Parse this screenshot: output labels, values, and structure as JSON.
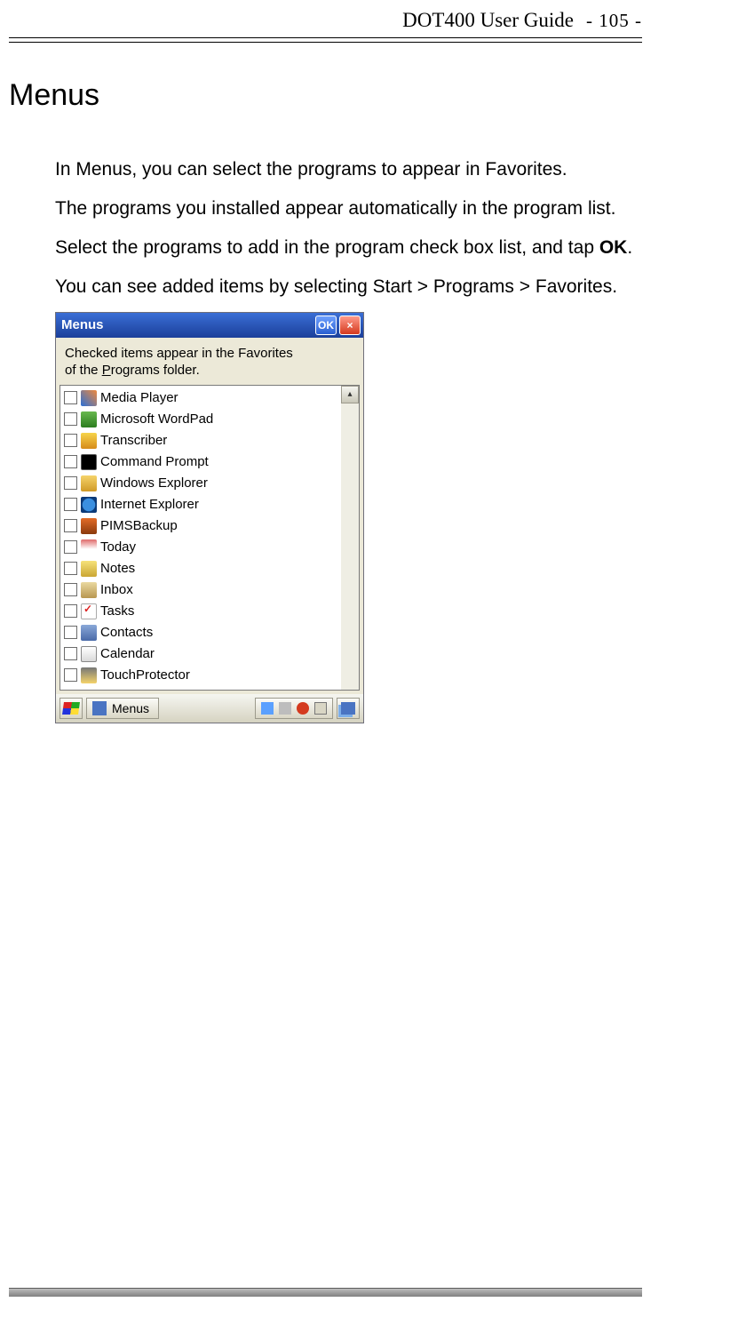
{
  "header": {
    "title": "DOT400 User Guide",
    "page": "- 105 -"
  },
  "heading": "Menus",
  "paragraphs": {
    "p1": "In Menus, you can select the programs to appear in Favorites.",
    "p2": "The programs you installed appear automatically in the program list.",
    "p3_before": "Select the programs to add in the program check box list, and tap ",
    "p3_bold": "OK",
    "p3_after": ".",
    "p4": "You can see added items by selecting Start > Programs > Favorites."
  },
  "pda": {
    "title": "Menus",
    "ok": "OK",
    "close": "×",
    "caption_line1": "Checked items appear in the Favorites",
    "caption_line2_a": "of the ",
    "caption_line2_u": "P",
    "caption_line2_b": "rograms folder.",
    "scroll_up": "▴",
    "items": [
      {
        "label": "Media Player",
        "icon": "ic-media"
      },
      {
        "label": "Microsoft WordPad",
        "icon": "ic-wordpad"
      },
      {
        "label": "Transcriber",
        "icon": "ic-transcriber"
      },
      {
        "label": "Command Prompt",
        "icon": "ic-cmd"
      },
      {
        "label": "Windows Explorer",
        "icon": "ic-explorer"
      },
      {
        "label": "Internet Explorer",
        "icon": "ic-ie"
      },
      {
        "label": "PIMSBackup",
        "icon": "ic-pims"
      },
      {
        "label": "Today",
        "icon": "ic-today"
      },
      {
        "label": "Notes",
        "icon": "ic-notes"
      },
      {
        "label": "Inbox",
        "icon": "ic-inbox"
      },
      {
        "label": "Tasks",
        "icon": "ic-tasks"
      },
      {
        "label": "Contacts",
        "icon": "ic-contacts"
      },
      {
        "label": "Calendar",
        "icon": "ic-calendar"
      },
      {
        "label": "TouchProtector",
        "icon": "ic-touch"
      }
    ],
    "taskbar": {
      "app": "Menus"
    }
  }
}
